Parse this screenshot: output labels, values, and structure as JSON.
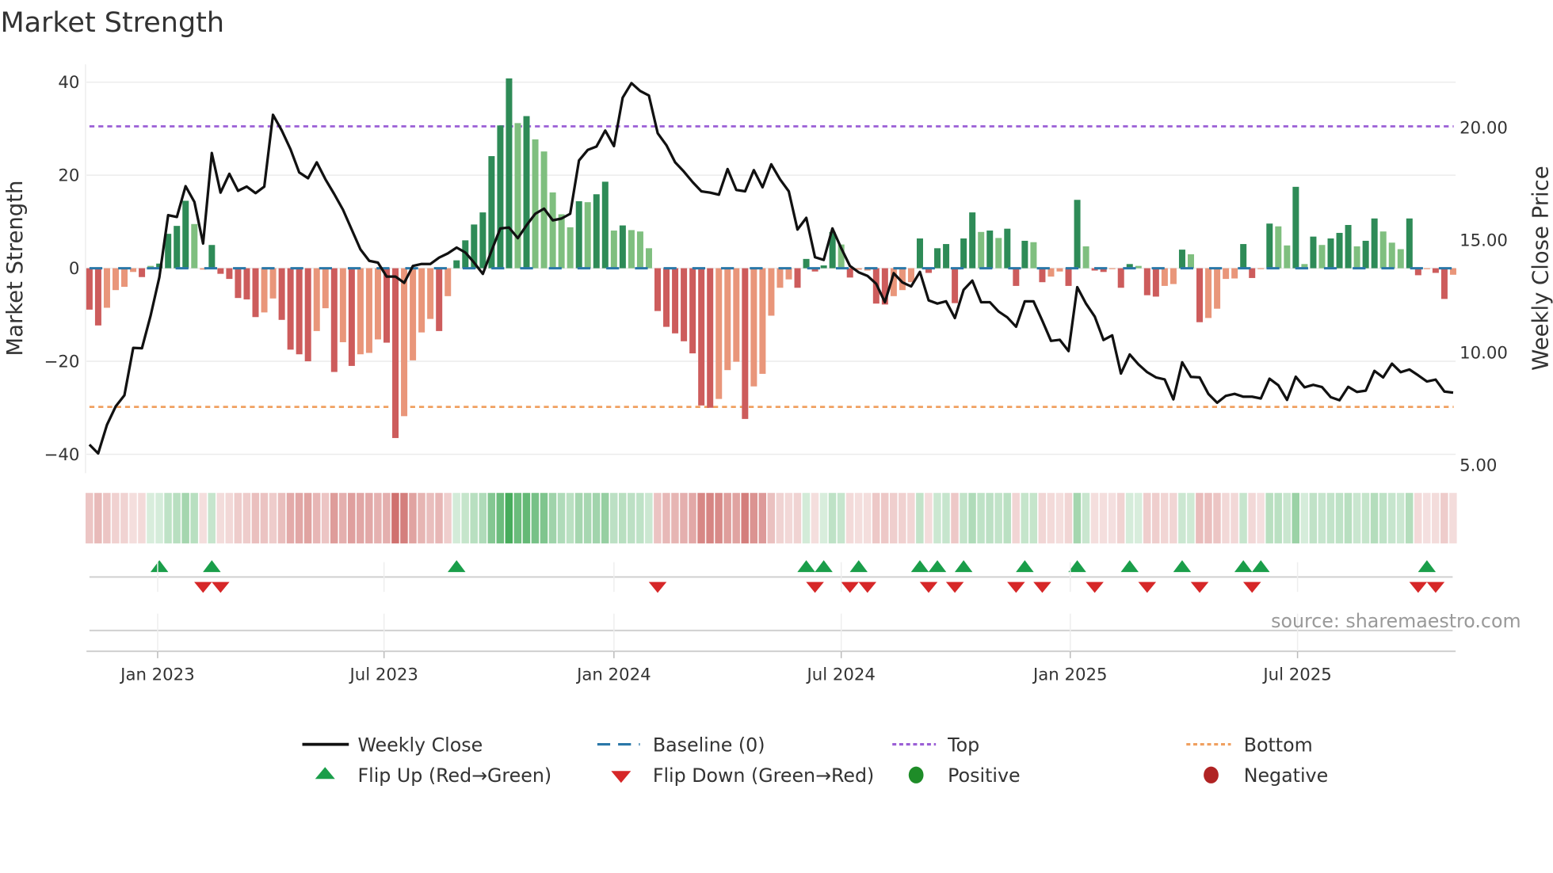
{
  "title": "Market Strength",
  "source": "source: sharemaestro.com",
  "chart_data": {
    "type": "bar+line",
    "title": "Market Strength",
    "ylabel": "Market Strength",
    "y2label": "Weekly Close Price",
    "ylim": [
      -44,
      44
    ],
    "y2lim": [
      4.5,
      23.2
    ],
    "yticks": [
      "40",
      "20",
      "0",
      "−20",
      "−40"
    ],
    "ytick_values": [
      40,
      20,
      0,
      -20,
      -40
    ],
    "y2ticks": [
      "20.00",
      "15.00",
      "10.00",
      "5.00"
    ],
    "y2tick_values": [
      20,
      15,
      10,
      5
    ],
    "xticks": [
      {
        "label": "Jan 2023",
        "week": 7.8
      },
      {
        "label": "Jul 2023",
        "week": 33.7
      },
      {
        "label": "Jan 2024",
        "week": 60.0
      },
      {
        "label": "Jul 2024",
        "week": 86.0
      },
      {
        "label": "Jan 2025",
        "week": 112.2
      },
      {
        "label": "Jul 2025",
        "week": 138.2
      }
    ],
    "top_level": 30.5,
    "bottom_level": -29.8,
    "baseline": 0,
    "strength": [
      -8.9,
      -12.3,
      -8.5,
      -4.7,
      -4,
      -0.8,
      -1.9,
      0.5,
      1,
      7.4,
      9.1,
      14.5,
      9.5,
      -0.3,
      5,
      -1.2,
      -2.3,
      -6.4,
      -6.7,
      -10.5,
      -9.5,
      -6.5,
      -11.1,
      -17.5,
      -18.5,
      -20,
      -13.5,
      -8.6,
      -22.3,
      -15.9,
      -21,
      -18.5,
      -18.2,
      -15.3,
      -16,
      -36.5,
      -31.8,
      -19.8,
      -13.8,
      -10.9,
      -13.5,
      -6,
      1.7,
      6,
      9.4,
      12,
      24.1,
      30.7,
      40.8,
      31.2,
      32.7,
      27.7,
      25.1,
      16.3,
      11.6,
      8.8,
      14.4,
      14.2,
      15.9,
      18.6,
      8.1,
      9.2,
      8.2,
      7.9,
      4.3,
      -9.2,
      -12.6,
      -14,
      -15.7,
      -18.3,
      -29.5,
      -30,
      -28.1,
      -21.9,
      -20.1,
      -32.4,
      -25.4,
      -22.7,
      -10.2,
      -4.2,
      -2.4,
      -4.2,
      2,
      -0.7,
      0.6,
      7.8,
      5.1,
      -2,
      -0.3,
      -0.5,
      -7.6,
      -7.8,
      -6,
      -4.7,
      -3,
      6.4,
      -1,
      4.3,
      5.2,
      -7.5,
      6.4,
      12,
      7.8,
      8.1,
      6.5,
      8.5,
      -3.8,
      5.9,
      5.6,
      -3,
      -1.8,
      -0.7,
      -3.8,
      14.7,
      4.7,
      -0.5,
      -0.8,
      -0.2,
      -4.2,
      0.9,
      0.5,
      -5.8,
      -6.1,
      -3.8,
      -3.4,
      4,
      3,
      -11.6,
      -10.7,
      -8.7,
      -2.3,
      -2.2,
      5.2,
      -2.1,
      -0.2,
      9.6,
      9,
      4.9,
      17.5,
      0.9,
      6.8,
      5,
      6.4,
      7.6,
      9.3,
      4.7,
      5.9,
      10.7,
      7.9,
      5.5,
      4.1,
      10.7,
      -1.5,
      -0.2,
      -1,
      -6.6,
      -1.4
    ],
    "shade": "ddlllldlddddllddddddllddddlldldlllddlllldldddddddldllllldlddldlllddddd ddllldllllldddddldllddllldddddddldldddldllddlddlddlddlldldllllddldlldldldddlddlllddlddl",
    "close": [
      5.87,
      5.48,
      6.75,
      7.57,
      8.06,
      10.17,
      10.15,
      11.61,
      13.31,
      16.07,
      15.99,
      17.36,
      16.66,
      14.81,
      18.83,
      17.07,
      17.91,
      17.15,
      17.34,
      17.05,
      17.34,
      20.53,
      19.83,
      19.0,
      17.97,
      17.71,
      18.42,
      17.66,
      17.01,
      16.31,
      15.43,
      14.55,
      14.04,
      13.96,
      13.34,
      13.34,
      13.06,
      13.81,
      13.9,
      13.9,
      14.18,
      14.37,
      14.63,
      14.41,
      13.96,
      13.46,
      14.49,
      15.48,
      15.52,
      15.05,
      15.62,
      16.13,
      16.36,
      15.84,
      15.92,
      16.13,
      18.5,
      18.97,
      19.12,
      19.83,
      19.14,
      21.29,
      21.94,
      21.59,
      21.39,
      19.71,
      19.18,
      18.42,
      18.01,
      17.54,
      17.13,
      17.07,
      16.98,
      18.12,
      17.19,
      17.13,
      18.07,
      17.31,
      18.33,
      17.66,
      17.13,
      15.43,
      15.95,
      14.2,
      14.08,
      15.48,
      14.6,
      13.81,
      13.53,
      13.37,
      13.02,
      12.2,
      13.49,
      13.08,
      12.9,
      13.55,
      12.28,
      12.14,
      12.24,
      11.5,
      12.75,
      13.16,
      12.2,
      12.2,
      11.79,
      11.53,
      11.11,
      12.24,
      12.24,
      11.38,
      10.48,
      10.53,
      10.03,
      12.87,
      12.14,
      11.56,
      10.52,
      10.73,
      9.03,
      9.88,
      9.44,
      9.09,
      8.86,
      8.77,
      7.88,
      9.53,
      8.88,
      8.86,
      8.13,
      7.73,
      8.04,
      8.13,
      8.0,
      8.0,
      7.92,
      8.8,
      8.51,
      7.86,
      8.89,
      8.42,
      8.53,
      8.43,
      7.98,
      7.84,
      8.44,
      8.21,
      8.27,
      9.15,
      8.86,
      9.47,
      9.09,
      9.21,
      8.95,
      8.68,
      8.76,
      8.23,
      8.18
    ],
    "flip_up_weeks": [
      8,
      14,
      42,
      82,
      84,
      88,
      95,
      97,
      100,
      107,
      113,
      119,
      125,
      132,
      134,
      153
    ],
    "flip_down_weeks": [
      13,
      15,
      65,
      83,
      87,
      89,
      96,
      99,
      106,
      109,
      115,
      121,
      127,
      133,
      152,
      154
    ],
    "legend": {
      "weekly_close": "Weekly Close",
      "baseline": "Baseline (0)",
      "top": "Top",
      "bottom": "Bottom",
      "flip_up": "Flip Up (Red→Green)",
      "flip_down": "Flip Down (Green→Red)",
      "positive": "Positive",
      "negative": "Negative"
    },
    "legend_placement": "bottom"
  },
  "colors": {
    "dark_green": "#2e8b57",
    "light_green": "#7fbf7f",
    "dark_red": "#cd5c5c",
    "light_red": "#e9967a",
    "line": "#111111",
    "baseline": "#2a77a8",
    "top": "#9b5fd6",
    "bottom": "#f0a060",
    "flip_up": "#1a9e4a",
    "flip_down": "#d62728",
    "positive": "#1e8c28",
    "negative": "#b02323"
  }
}
